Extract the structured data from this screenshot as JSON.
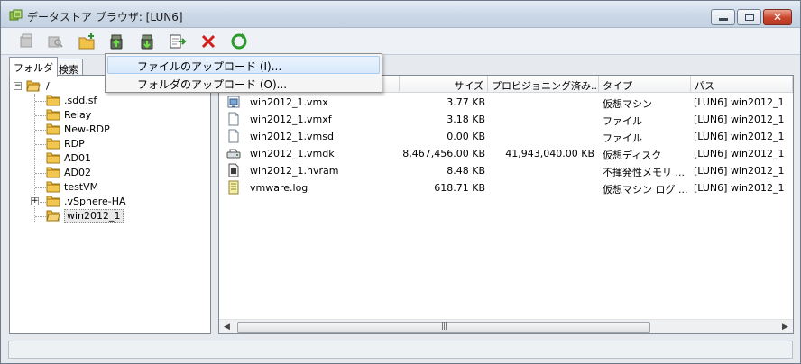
{
  "window": {
    "title": "データストア ブラウザ: [LUN6]",
    "controls": {
      "minimize": "minimize",
      "maximize": "maximize",
      "close": "close"
    }
  },
  "toolbar": {
    "buttons": [
      {
        "icon": "datastore-icon",
        "enabled": false
      },
      {
        "icon": "search-datastore-icon",
        "enabled": false
      },
      {
        "icon": "new-folder-icon",
        "enabled": true
      },
      {
        "icon": "upload-icon",
        "enabled": true
      },
      {
        "icon": "download-icon",
        "enabled": true
      },
      {
        "icon": "move-icon",
        "enabled": true
      },
      {
        "icon": "delete-icon",
        "enabled": true
      },
      {
        "icon": "refresh-icon",
        "enabled": true
      }
    ]
  },
  "tabs": {
    "folders": "フォルダ",
    "search": "検索"
  },
  "upload_menu": {
    "items": [
      {
        "label": "ファイルのアップロード (I)...",
        "highlighted": true
      },
      {
        "label": "フォルダのアップロード (O)...",
        "highlighted": false
      }
    ]
  },
  "tree": {
    "root": "/",
    "items": [
      {
        "label": ".sdd.sf",
        "expandable": false,
        "selected": false
      },
      {
        "label": "Relay",
        "expandable": false,
        "selected": false
      },
      {
        "label": "New-RDP",
        "expandable": false,
        "selected": false
      },
      {
        "label": "RDP",
        "expandable": false,
        "selected": false
      },
      {
        "label": "AD01",
        "expandable": false,
        "selected": false
      },
      {
        "label": "AD02",
        "expandable": false,
        "selected": false
      },
      {
        "label": "testVM",
        "expandable": false,
        "selected": false
      },
      {
        "label": ".vSphere-HA",
        "expandable": true,
        "selected": false
      },
      {
        "label": "win2012_1",
        "expandable": false,
        "selected": true
      }
    ]
  },
  "file_list": {
    "columns": {
      "size": "サイズ",
      "provisioned": "プロビジョニング済み...",
      "type": "タイプ",
      "path": "パス"
    },
    "rows": [
      {
        "icon": "vm-config-icon",
        "name": "win2012_1.vmx",
        "size": "3.77 KB",
        "provisioned": "",
        "type": "仮想マシン",
        "path": "[LUN6] win2012_1"
      },
      {
        "icon": "file-icon",
        "name": "win2012_1.vmxf",
        "size": "3.18 KB",
        "provisioned": "",
        "type": "ファイル",
        "path": "[LUN6] win2012_1"
      },
      {
        "icon": "file-icon",
        "name": "win2012_1.vmsd",
        "size": "0.00 KB",
        "provisioned": "",
        "type": "ファイル",
        "path": "[LUN6] win2012_1"
      },
      {
        "icon": "virtual-disk-icon",
        "name": "win2012_1.vmdk",
        "size": "8,467,456.00 KB",
        "provisioned": "41,943,040.00 KB",
        "type": "仮想ディスク",
        "path": "[LUN6] win2012_1"
      },
      {
        "icon": "nvram-icon",
        "name": "win2012_1.nvram",
        "size": "8.48 KB",
        "provisioned": "",
        "type": "不揮発性メモリ ...",
        "path": "[LUN6] win2012_1"
      },
      {
        "icon": "log-icon",
        "name": "vmware.log",
        "size": "618.71 KB",
        "provisioned": "",
        "type": "仮想マシン ログ ...",
        "path": "[LUN6] win2012_1"
      }
    ]
  },
  "scrollbar": {
    "grip": "|||"
  }
}
